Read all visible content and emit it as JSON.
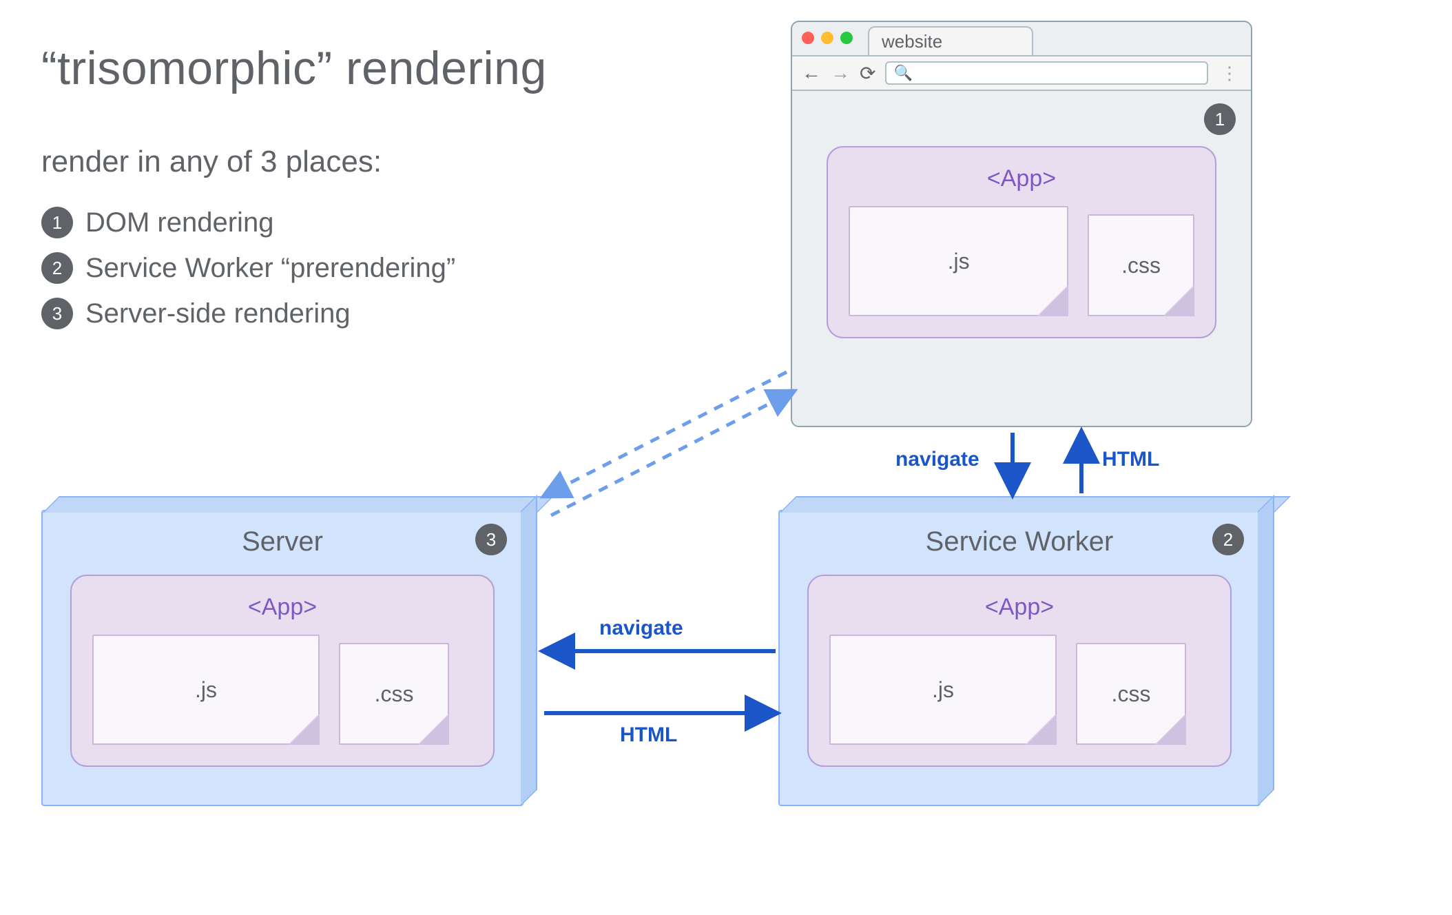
{
  "title": "“trisomorphic” rendering",
  "subtitle": "render in any of 3 places:",
  "bullets": [
    {
      "num": "1",
      "text": "DOM rendering"
    },
    {
      "num": "2",
      "text": "Service Worker “prerendering”"
    },
    {
      "num": "3",
      "text": "Server-side rendering"
    }
  ],
  "browser": {
    "tab_label": "website",
    "badge": "1",
    "app_label": "<App>",
    "file_js": ".js",
    "file_css": ".css",
    "search_placeholder": ""
  },
  "server_box": {
    "title": "Server",
    "badge": "3",
    "app_label": "<App>",
    "file_js": ".js",
    "file_css": ".css"
  },
  "sw_box": {
    "title": "Service Worker",
    "badge": "2",
    "app_label": "<App>",
    "file_js": ".js",
    "file_css": ".css"
  },
  "arrows": {
    "browser_sw_down": "navigate",
    "browser_sw_up": "HTML",
    "sw_server_left": "navigate",
    "sw_server_right": "HTML"
  },
  "icons": {
    "back": "←",
    "forward": "→",
    "reload": "⟳",
    "search": "🔍",
    "menu": "⋮"
  }
}
